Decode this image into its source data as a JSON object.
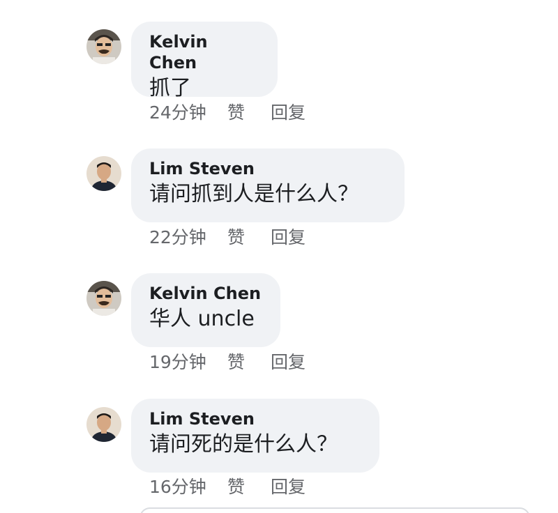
{
  "comments": [
    {
      "author": "Kelvin Chen",
      "text": "抓了",
      "time": "24分钟",
      "like": "赞",
      "reply": "回复",
      "avatar_icon": "man-with-mustache-avatar"
    },
    {
      "author": "Lim Steven",
      "text": "请问抓到人是什么人？",
      "time": "22分钟",
      "like": "赞",
      "reply": "回复",
      "avatar_icon": "man-dark-jacket-avatar"
    },
    {
      "author": "Kelvin Chen",
      "text": "华人 uncle",
      "time": "19分钟",
      "like": "赞",
      "reply": "回复",
      "avatar_icon": "man-with-mustache-avatar"
    },
    {
      "author": "Lim Steven",
      "text": "请问死的是什么人？",
      "time": "16分钟",
      "like": "赞",
      "reply": "回复",
      "avatar_icon": "man-dark-jacket-avatar"
    }
  ],
  "colors": {
    "bubble_bg": "#f0f2f5",
    "author_text": "#1c1e21",
    "meta_text": "#65676b"
  }
}
